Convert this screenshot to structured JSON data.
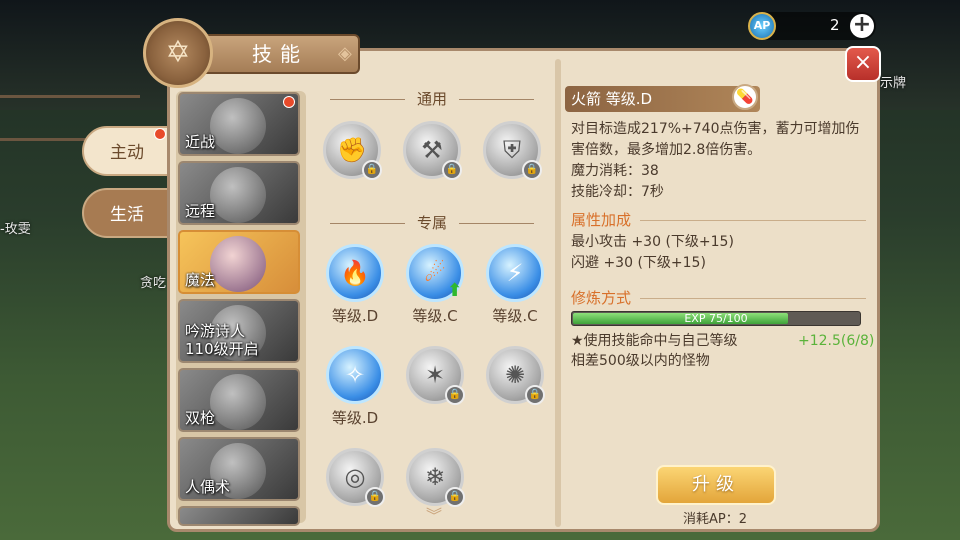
{
  "hud": {
    "ap_icon_label": "AP",
    "ap_value": "2",
    "ap_plus": "+"
  },
  "background": {
    "left_text": "-玫雯",
    "mid_text": "贪吃",
    "right_text": "示牌"
  },
  "window": {
    "title": "技能",
    "close_label": "×"
  },
  "side_tabs": [
    {
      "label": "主动",
      "active": true,
      "has_notification": true
    },
    {
      "label": "生活",
      "active": false,
      "has_notification": false
    }
  ],
  "classes": [
    {
      "label": "近战",
      "selected": false,
      "locked": false,
      "has_notification": true
    },
    {
      "label": "远程",
      "selected": false,
      "locked": false,
      "has_notification": false
    },
    {
      "label": "魔法",
      "selected": true,
      "locked": false,
      "has_notification": false
    },
    {
      "label": "吟游诗人\n110级开启",
      "selected": false,
      "locked": true,
      "has_notification": false
    },
    {
      "label": "双枪",
      "selected": false,
      "locked": true,
      "has_notification": false
    },
    {
      "label": "人偶术",
      "selected": false,
      "locked": true,
      "has_notification": false
    }
  ],
  "sections": {
    "common": "通用",
    "exclusive": "专属"
  },
  "common_skills": [
    {
      "icon": "fist-icon",
      "locked": true
    },
    {
      "icon": "hammer-icon",
      "locked": true
    },
    {
      "icon": "shield-icon",
      "locked": true
    }
  ],
  "exclusive_skills": [
    {
      "icon": "fire-arrow-icon",
      "locked": false,
      "level": "等级.D",
      "can_upgrade": false
    },
    {
      "icon": "meteor-icon",
      "locked": false,
      "level": "等级.C",
      "can_upgrade": true
    },
    {
      "icon": "lightning-icon",
      "locked": false,
      "level": "等级.C",
      "can_upgrade": false
    },
    {
      "icon": "arcane-bolt-icon",
      "locked": false,
      "level": "等级.D",
      "can_upgrade": false
    },
    {
      "icon": "figure-icon",
      "locked": true,
      "level": "",
      "can_upgrade": false
    },
    {
      "icon": "burst-icon",
      "locked": true,
      "level": "",
      "can_upgrade": false
    },
    {
      "icon": "orb-icon",
      "locked": true,
      "level": "",
      "can_upgrade": false
    },
    {
      "icon": "frost-icon",
      "locked": true,
      "level": "",
      "can_upgrade": false
    }
  ],
  "detail": {
    "skill_title": "火箭  等级.D",
    "description_1": "对目标造成217%+740点伤害，蓄力可增加伤",
    "description_2": "害倍数，最多增加2.8倍伤害。",
    "mana_cost": "魔力消耗：38",
    "cooldown": "技能冷却：7秒",
    "attr_header": "属性加成",
    "attr_1": "最小攻击 +30 (下级+15)",
    "attr_2": "闪避 +30 (下级+15)",
    "train_header": "修炼方式",
    "exp_text": "EXP 75/100",
    "exp_progress": 0.75,
    "train_desc_1": "★使用技能命中与自己等级",
    "train_desc_2": "相差500级以内的怪物",
    "train_bonus": "+12.5(6/8)",
    "upgrade_label": "升级",
    "cost_text": "消耗AP：2"
  },
  "colors": {
    "accent": "#d8702a",
    "panel": "#ecdfc8",
    "exp_fill": "#3fa33a",
    "upgrade": "#e3a53a"
  }
}
